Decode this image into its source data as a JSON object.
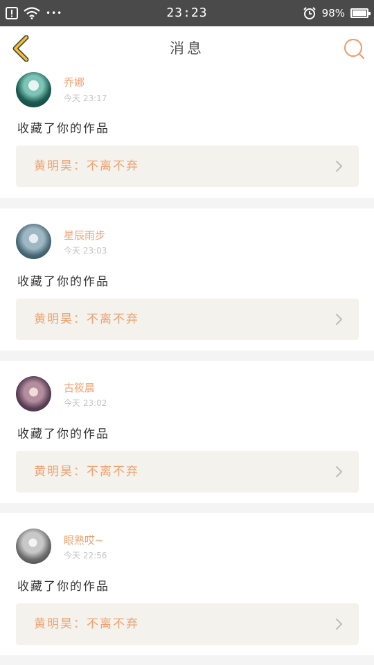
{
  "status_bar": {
    "time": "23:23",
    "battery": "98%",
    "battery_level": 0.98,
    "more_icon": "•••"
  },
  "header": {
    "title": "消息"
  },
  "colors": {
    "accent": "#f0a070",
    "back_arrow": "#f1c232",
    "link_bg": "#f3f2ec"
  },
  "notifications": [
    {
      "username": "乔娜",
      "time": "今天 23:17",
      "action": "收藏了你的作品",
      "work": "黄明昊：不离不弃"
    },
    {
      "username": "星辰雨步",
      "time": "今天 23:03",
      "action": "收藏了你的作品",
      "work": "黄明昊：不离不弃"
    },
    {
      "username": "古筱晨",
      "time": "今天 23:02",
      "action": "收藏了你的作品",
      "work": "黄明昊：不离不弃"
    },
    {
      "username": "眼熟哎~",
      "time": "今天 22:56",
      "action": "收藏了你的作品",
      "work": "黄明昊：不离不弃"
    }
  ]
}
